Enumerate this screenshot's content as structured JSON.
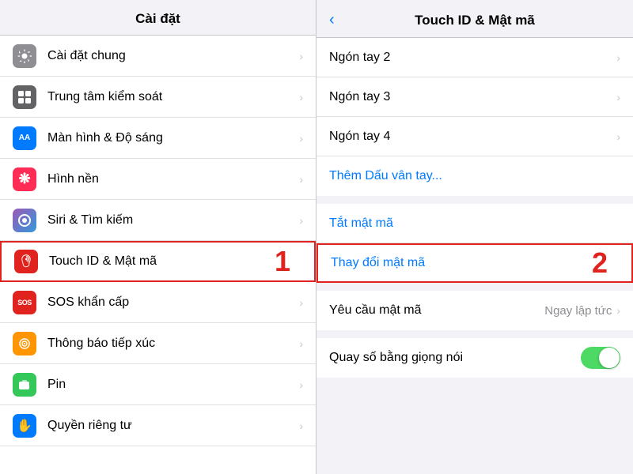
{
  "left": {
    "header": "Cài đặt",
    "items": [
      {
        "id": "cai-dat-chung",
        "label": "Cài đặt chung",
        "icon": "⚙️",
        "iconBg": "gray",
        "highlighted": false
      },
      {
        "id": "trung-tam",
        "label": "Trung tâm kiểm soát",
        "icon": "⊞",
        "iconBg": "gray",
        "highlighted": false
      },
      {
        "id": "man-hinh",
        "label": "Màn hình & Độ sáng",
        "icon": "AA",
        "iconBg": "blue",
        "highlighted": false
      },
      {
        "id": "hinh-nen",
        "label": "Hình nền",
        "icon": "🌸",
        "iconBg": "pink",
        "highlighted": false
      },
      {
        "id": "siri",
        "label": "Siri & Tìm kiếm",
        "icon": "◎",
        "iconBg": "purple",
        "highlighted": false
      },
      {
        "id": "touch-id",
        "label": "Touch ID & Mật mã",
        "icon": "👆",
        "iconBg": "red",
        "highlighted": true
      },
      {
        "id": "sos",
        "label": "SOS khẩn cấp",
        "icon": "SOS",
        "iconBg": "sos",
        "highlighted": false
      },
      {
        "id": "thong-bao",
        "label": "Thông báo tiếp xúc",
        "icon": "◉",
        "iconBg": "orange",
        "highlighted": false
      },
      {
        "id": "pin",
        "label": "Pin",
        "icon": "🔋",
        "iconBg": "green",
        "highlighted": false
      },
      {
        "id": "quyen-rieng",
        "label": "Quyền riêng tư",
        "icon": "✋",
        "iconBg": "blue",
        "highlighted": false
      }
    ],
    "step_label": "1"
  },
  "right": {
    "header": "Touch ID & Mật mã",
    "back_label": "",
    "sections": [
      {
        "items": [
          {
            "id": "ngon-tay-2",
            "label": "Ngón tay 2",
            "type": "nav",
            "value": ""
          },
          {
            "id": "ngon-tay-3",
            "label": "Ngón tay 3",
            "type": "nav",
            "value": ""
          },
          {
            "id": "ngon-tay-4",
            "label": "Ngón tay 4",
            "type": "nav",
            "value": ""
          },
          {
            "id": "them-dau-van-tay",
            "label": "Thêm Dấu vân tay...",
            "type": "blue-action",
            "value": ""
          }
        ]
      },
      {
        "items": [
          {
            "id": "tat-mat-ma",
            "label": "Tắt mật mã",
            "type": "blue-action",
            "value": ""
          },
          {
            "id": "thay-doi-mat-ma",
            "label": "Thay đổi mật mã",
            "type": "blue-action",
            "value": "",
            "highlighted": true
          }
        ]
      },
      {
        "items": [
          {
            "id": "yeu-cau-mat-ma",
            "label": "Yêu cầu mật mã",
            "type": "nav-value",
            "value": "Ngay lập tức"
          }
        ]
      },
      {
        "items": [
          {
            "id": "quay-so-giong-noi",
            "label": "Quay số bằng giọng nói",
            "type": "toggle",
            "value": ""
          }
        ]
      }
    ],
    "step_label": "2"
  }
}
